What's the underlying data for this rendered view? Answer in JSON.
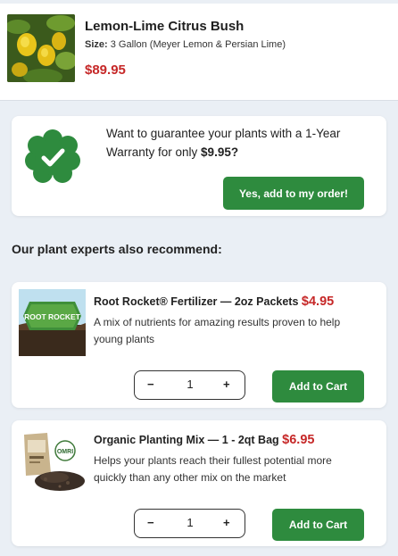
{
  "cart_item": {
    "title": "Lemon-Lime Citrus Bush",
    "size_label": "Size:",
    "size_value": "3 Gallon (Meyer Lemon & Persian Lime)",
    "price": "$89.95"
  },
  "warranty": {
    "text": "Want to guarantee your plants with a 1-Year Warranty for only",
    "price": "$9.95?",
    "button_label": "Yes, add to my order!",
    "icon": "check-badge-icon"
  },
  "recommend": {
    "heading": "Our plant experts also recommend:",
    "items": [
      {
        "title": "Root Rocket® Fertilizer — 2oz Packets",
        "price": "$4.95",
        "description": "A mix of nutrients for amazing results proven to help young plants",
        "image_text": "ROOT ROCKET",
        "quantity": "1",
        "add_label": "Add to Cart"
      },
      {
        "title": "Organic Planting Mix — 1 - 2qt Bag",
        "price": "$6.95",
        "description": "Helps your plants reach their fullest potential more quickly than any other mix on the market",
        "image_text": "OMRI",
        "quantity": "1",
        "add_label": "Add to Cart"
      }
    ]
  },
  "stepper": {
    "minus": "−",
    "plus": "+"
  },
  "colors": {
    "accent_green": "#2e8b3e",
    "price_red": "#c62828",
    "page_bg": "#eaeff5"
  }
}
